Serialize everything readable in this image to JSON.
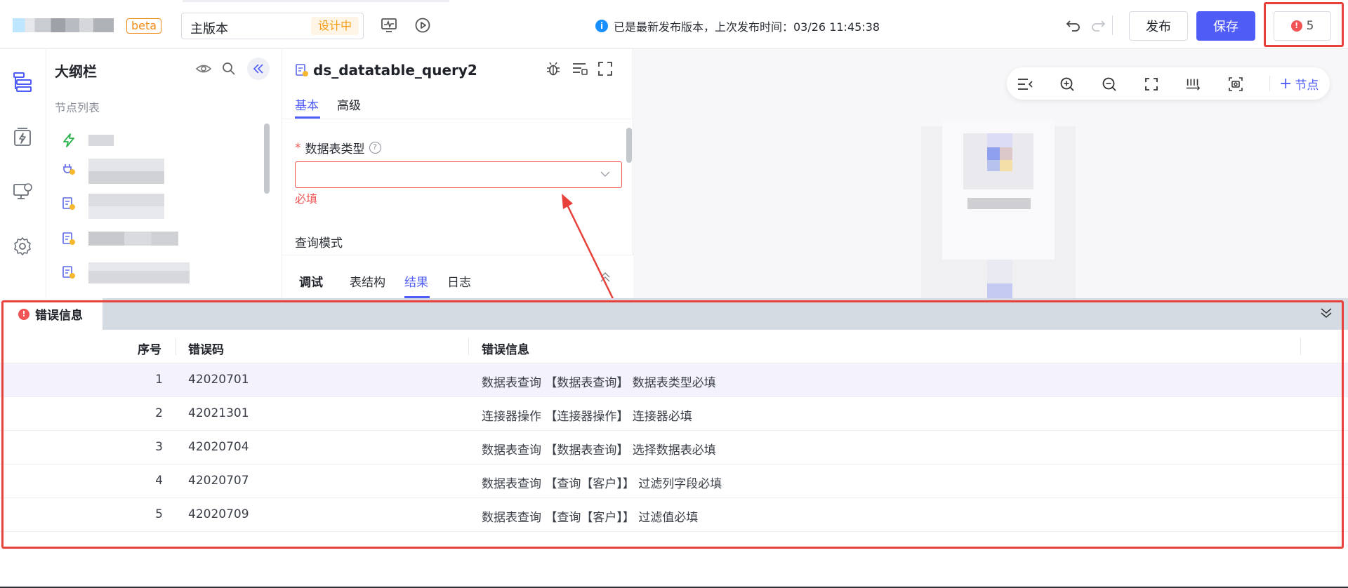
{
  "header": {
    "beta_label": "beta",
    "version_name": "主版本",
    "version_status": "设计中",
    "publish_status": "已是最新发布版本，上次发布时间：03/26 11:45:38",
    "publish_button": "发布",
    "save_button": "保存",
    "error_count": "5"
  },
  "outline": {
    "title": "大纲栏",
    "subtitle": "节点列表"
  },
  "props": {
    "node_title": "ds_datatable_query2",
    "tabs": [
      "基本",
      "高级"
    ],
    "field_label": "数据表类型",
    "required_marker": "*",
    "help_symbol": "?",
    "required_message": "必填",
    "query_mode_label": "查询模式",
    "debug_tabs": [
      "调试",
      "表结构",
      "结果",
      "日志"
    ]
  },
  "canvas": {
    "add_node_label": "节点"
  },
  "errors": {
    "tab_title": "错误信息",
    "columns": [
      "序号",
      "错误码",
      "错误信息"
    ],
    "rows": [
      {
        "index": "1",
        "code": "42020701",
        "message": "数据表查询 【数据表查询】 数据表类型必填"
      },
      {
        "index": "2",
        "code": "42021301",
        "message": "连接器操作 【连接器操作】 连接器必填"
      },
      {
        "index": "3",
        "code": "42020704",
        "message": "数据表查询 【数据表查询】 选择数据表必填"
      },
      {
        "index": "4",
        "code": "42020707",
        "message": "数据表查询 【查询【客户】】 过滤列字段必填"
      },
      {
        "index": "5",
        "code": "42020709",
        "message": "数据表查询 【查询【客户】】 过滤值必填"
      }
    ]
  },
  "colors": {
    "accent": "#4f5cf5",
    "error": "#f05454",
    "warning": "#f08c1a",
    "highlight_frame": "#e8413b"
  }
}
